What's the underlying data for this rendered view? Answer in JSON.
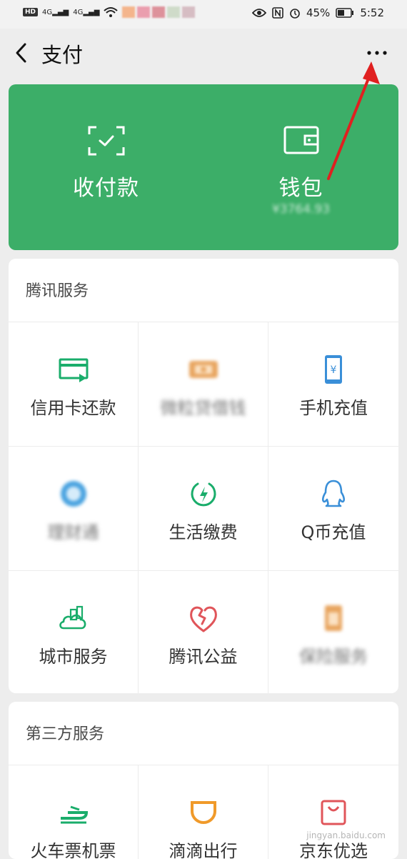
{
  "status_bar": {
    "hd": "HD",
    "net1": "4G",
    "net2": "4G",
    "battery": "45%",
    "time": "5:52"
  },
  "nav": {
    "title": "支付"
  },
  "wallet_card": {
    "pay_label": "收付款",
    "wallet_label": "钱包",
    "wallet_balance": "¥3764.93"
  },
  "tencent_services": {
    "title": "腾讯服务",
    "items": [
      {
        "label": "信用卡还款",
        "icon": "credit-card-icon",
        "blurred": false
      },
      {
        "label": "微粒贷借钱",
        "icon": "loan-icon",
        "blurred": true
      },
      {
        "label": "手机充值",
        "icon": "phone-topup-icon",
        "blurred": false
      },
      {
        "label": "理财通",
        "icon": "wealth-icon",
        "blurred": true
      },
      {
        "label": "生活缴费",
        "icon": "utility-bill-icon",
        "blurred": false
      },
      {
        "label": "Q币充值",
        "icon": "qq-penguin-icon",
        "blurred": false
      },
      {
        "label": "城市服务",
        "icon": "city-service-icon",
        "blurred": false
      },
      {
        "label": "腾讯公益",
        "icon": "charity-heart-icon",
        "blurred": false
      },
      {
        "label": "保险服务",
        "icon": "insurance-icon",
        "blurred": true
      }
    ]
  },
  "third_party_services": {
    "title": "第三方服务",
    "items": [
      {
        "label": "火车票机票",
        "icon": "train-icon"
      },
      {
        "label": "滴滴出行",
        "icon": "didi-icon"
      },
      {
        "label": "京东优选",
        "icon": "jd-shopping-icon"
      }
    ]
  },
  "watermark": "jingyan.baidu.com",
  "colors": {
    "brand_green": "#3cae68",
    "icon_green": "#1aad6b",
    "arrow_red": "#e02020",
    "background": "#ededed"
  }
}
